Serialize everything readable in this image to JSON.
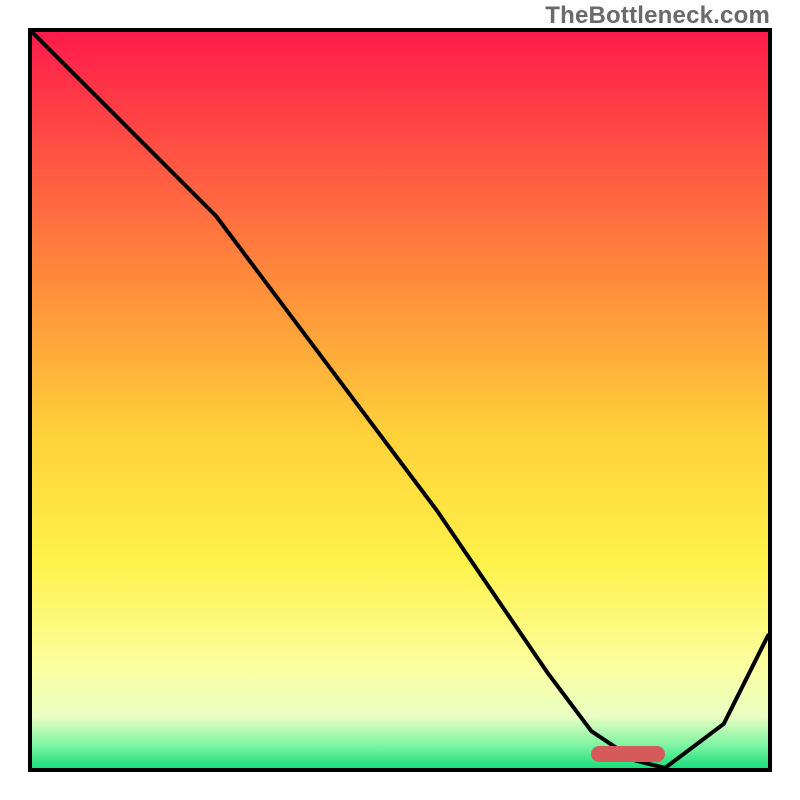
{
  "watermark": "TheBottleneck.com",
  "chart_data": {
    "type": "line",
    "title": "",
    "xlabel": "",
    "ylabel": "",
    "xlim": [
      0,
      100
    ],
    "ylim": [
      0,
      100
    ],
    "gradient_stops": [
      {
        "pct": 0,
        "color": "#ff1b4b"
      },
      {
        "pct": 35,
        "color": "#ff8f3b"
      },
      {
        "pct": 55,
        "color": "#ffd23a"
      },
      {
        "pct": 72,
        "color": "#fff24a"
      },
      {
        "pct": 86,
        "color": "#fbff9e"
      },
      {
        "pct": 93,
        "color": "#e9ffc3"
      },
      {
        "pct": 97,
        "color": "#7cf3a2"
      },
      {
        "pct": 100,
        "color": "#19e07a"
      }
    ],
    "series": [
      {
        "name": "curve",
        "x": [
          0,
          10,
          25,
          40,
          55,
          70,
          76,
          82,
          86,
          94,
          100
        ],
        "y": [
          100,
          90,
          75,
          55,
          35,
          13,
          5,
          1,
          0,
          6,
          18
        ]
      }
    ],
    "marker": {
      "x0": 76,
      "x1": 86,
      "y": 0.8,
      "height": 2.2
    }
  }
}
